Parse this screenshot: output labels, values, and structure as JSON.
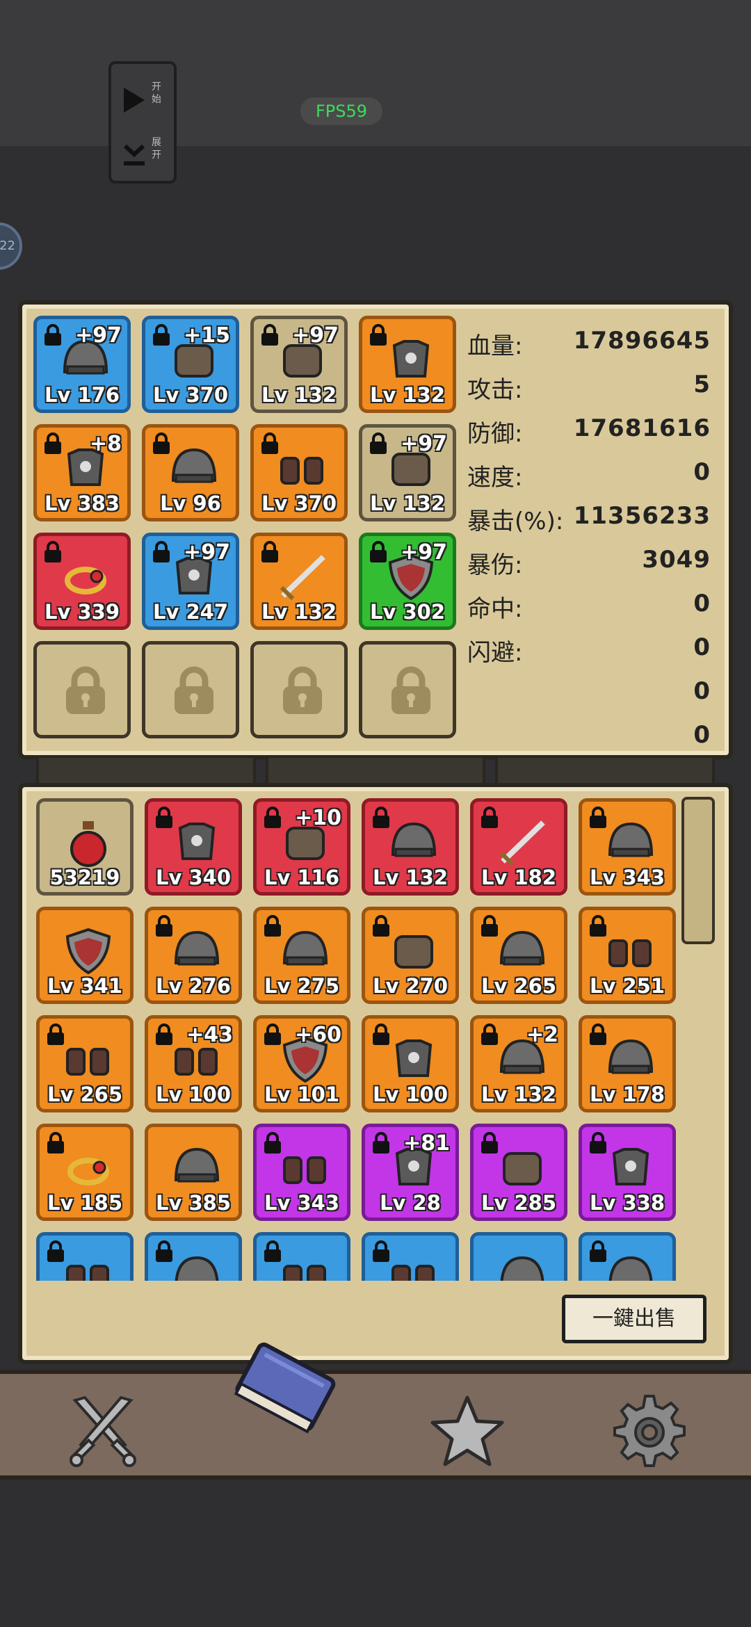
{
  "floater": {
    "start_label": "开始",
    "expand_label": "展开"
  },
  "fps": "FPS59",
  "side_badge": "22",
  "stats": [
    {
      "label": "血量:",
      "value": "17896645"
    },
    {
      "label": "攻击:",
      "value": "5"
    },
    {
      "label": "防御:",
      "value": "17681616"
    },
    {
      "label": "速度:",
      "value": "0"
    },
    {
      "label": "暴击(%):",
      "value": "11356233"
    },
    {
      "label": "暴伤:",
      "value": "3049"
    },
    {
      "label": "命中:",
      "value": "0"
    },
    {
      "label": "闪避:",
      "value": "0"
    },
    {
      "label": "",
      "value": "0"
    },
    {
      "label": "",
      "value": "0"
    }
  ],
  "equipped": [
    {
      "level": "Lv 176",
      "plus": "+97",
      "rarity": "blue",
      "icon": "viking-helmet-icon"
    },
    {
      "level": "Lv 370",
      "plus": "+15",
      "rarity": "blue",
      "icon": "bandana-icon"
    },
    {
      "level": "Lv 132",
      "plus": "+97",
      "rarity": "gray",
      "icon": "leaf-icon"
    },
    {
      "level": "Lv 132",
      "plus": "",
      "rarity": "orange",
      "icon": "gold-armor-icon"
    },
    {
      "level": "Lv 383",
      "plus": "+8",
      "rarity": "orange",
      "icon": "blue-armor-icon"
    },
    {
      "level": "Lv 96",
      "plus": "",
      "rarity": "orange",
      "icon": "dark-hood-icon"
    },
    {
      "level": "Lv 370",
      "plus": "",
      "rarity": "orange",
      "icon": "boots-icon"
    },
    {
      "level": "Lv 132",
      "plus": "+97",
      "rarity": "gray",
      "icon": "belt-icon"
    },
    {
      "level": "Lv 339",
      "plus": "",
      "rarity": "red",
      "icon": "ring-icon"
    },
    {
      "level": "Lv 247",
      "plus": "+97",
      "rarity": "blue",
      "icon": "chainmail-icon"
    },
    {
      "level": "Lv 132",
      "plus": "",
      "rarity": "orange",
      "icon": "katana-icon"
    },
    {
      "level": "Lv 302",
      "plus": "+97",
      "rarity": "green",
      "icon": "round-shield-icon"
    },
    {
      "level": "",
      "plus": "",
      "rarity": "empty",
      "icon": "lock-icon"
    },
    {
      "level": "",
      "plus": "",
      "rarity": "empty",
      "icon": "lock-icon"
    },
    {
      "level": "",
      "plus": "",
      "rarity": "empty",
      "icon": "lock-icon"
    },
    {
      "level": "",
      "plus": "",
      "rarity": "empty",
      "icon": "lock-icon"
    }
  ],
  "inventory": [
    {
      "level": "53219",
      "plus": "",
      "rarity": "gray",
      "icon": "potion-icon",
      "locked": false
    },
    {
      "level": "Lv 340",
      "plus": "",
      "rarity": "red",
      "icon": "skull-armor-icon",
      "locked": true
    },
    {
      "level": "Lv 116",
      "plus": "+10",
      "rarity": "red",
      "icon": "feather-icon",
      "locked": true
    },
    {
      "level": "Lv 132",
      "plus": "",
      "rarity": "red",
      "icon": "knight-helmet-icon",
      "locked": true
    },
    {
      "level": "Lv 182",
      "plus": "",
      "rarity": "red",
      "icon": "sword-icon",
      "locked": true
    },
    {
      "level": "Lv 343",
      "plus": "",
      "rarity": "orange",
      "icon": "purple-helmet-icon",
      "locked": true
    },
    {
      "level": "Lv 341",
      "plus": "",
      "rarity": "orange",
      "icon": "shield-icon",
      "locked": false
    },
    {
      "level": "Lv 276",
      "plus": "",
      "rarity": "orange",
      "icon": "wood-mask-icon",
      "locked": true
    },
    {
      "level": "Lv 275",
      "plus": "",
      "rarity": "orange",
      "icon": "iron-helmet-icon",
      "locked": true
    },
    {
      "level": "Lv 270",
      "plus": "",
      "rarity": "orange",
      "icon": "skirt-icon",
      "locked": true
    },
    {
      "level": "Lv 265",
      "plus": "",
      "rarity": "orange",
      "icon": "skull-hood-icon",
      "locked": true
    },
    {
      "level": "Lv 251",
      "plus": "",
      "rarity": "orange",
      "icon": "glove-icon",
      "locked": true
    },
    {
      "level": "Lv 265",
      "plus": "",
      "rarity": "orange",
      "icon": "greaves-icon",
      "locked": true
    },
    {
      "level": "Lv 100",
      "plus": "+43",
      "rarity": "orange",
      "icon": "red-boots-icon",
      "locked": true
    },
    {
      "level": "Lv 101",
      "plus": "+60",
      "rarity": "orange",
      "icon": "kite-shield-icon",
      "locked": true
    },
    {
      "level": "Lv 100",
      "plus": "",
      "rarity": "orange",
      "icon": "gold-armor-icon",
      "locked": true
    },
    {
      "level": "Lv 132",
      "plus": "+2",
      "rarity": "orange",
      "icon": "red-mask-icon",
      "locked": true
    },
    {
      "level": "Lv 178",
      "plus": "",
      "rarity": "orange",
      "icon": "skull-hood-icon",
      "locked": true
    },
    {
      "level": "Lv 185",
      "plus": "",
      "rarity": "orange",
      "icon": "ring-icon",
      "locked": true
    },
    {
      "level": "Lv 385",
      "plus": "",
      "rarity": "orange",
      "icon": "bone-helmet-icon",
      "locked": false
    },
    {
      "level": "Lv 343",
      "plus": "",
      "rarity": "purple",
      "icon": "gauntlet-icon",
      "locked": true
    },
    {
      "level": "Lv 28",
      "plus": "+81",
      "rarity": "purple",
      "icon": "leather-armor-icon",
      "locked": true
    },
    {
      "level": "Lv 285",
      "plus": "",
      "rarity": "purple",
      "icon": "pants-icon",
      "locked": true
    },
    {
      "level": "Lv 338",
      "plus": "",
      "rarity": "purple",
      "icon": "plate-armor-icon",
      "locked": true
    },
    {
      "level": "",
      "plus": "",
      "rarity": "blue",
      "icon": "boots-icon",
      "locked": true
    },
    {
      "level": "",
      "plus": "",
      "rarity": "blue",
      "icon": "tower-helmet-icon",
      "locked": true
    },
    {
      "level": "",
      "plus": "",
      "rarity": "blue",
      "icon": "boots-icon",
      "locked": true
    },
    {
      "level": "",
      "plus": "",
      "rarity": "blue",
      "icon": "gauntlet-icon",
      "locked": true
    },
    {
      "level": "",
      "plus": "",
      "rarity": "blue",
      "icon": "horn-helmet-icon",
      "locked": false
    },
    {
      "level": "",
      "plus": "",
      "rarity": "blue",
      "icon": "round-helmet-icon",
      "locked": true
    }
  ],
  "sell_button": "一鍵出售",
  "nav": [
    {
      "name": "battle",
      "icon": "crossed-swords-icon"
    },
    {
      "name": "book",
      "icon": "book-icon"
    },
    {
      "name": "favorites",
      "icon": "star-icon"
    },
    {
      "name": "settings",
      "icon": "gear-icon"
    }
  ]
}
